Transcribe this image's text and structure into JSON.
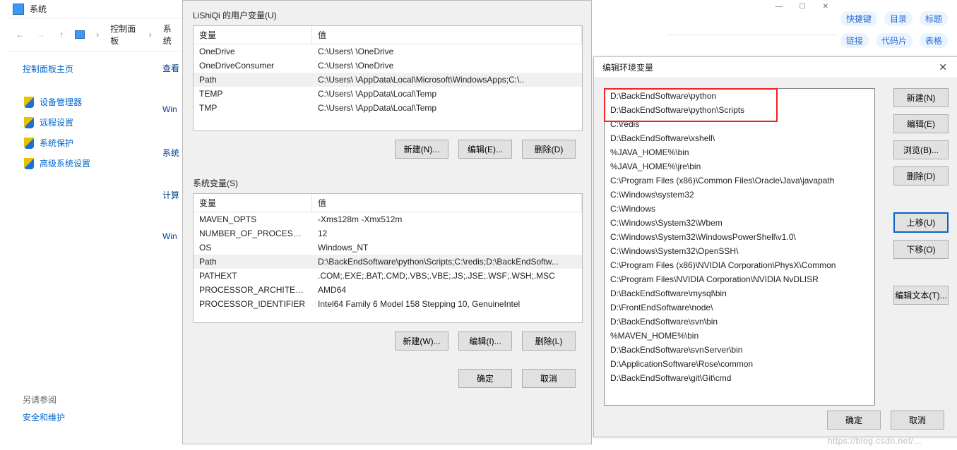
{
  "cp": {
    "title": "系统",
    "crumb1": "控制面板",
    "crumb2": "系统",
    "home": "控制面板主页",
    "items": [
      "设备管理器",
      "远程设置",
      "系统保护",
      "高级系统设置"
    ],
    "see_also": "另请参阅",
    "sec": "安全和维护"
  },
  "truncated": [
    "查看",
    "Win",
    "系统",
    "计算",
    "Win"
  ],
  "env": {
    "user_title": "LiShiQi 的用户变量(U)",
    "sys_title": "系统变量(S)",
    "col_var": "变量",
    "col_val": "值",
    "user_rows": [
      {
        "var": "OneDrive",
        "val": "C:\\Users\\        \\OneDrive"
      },
      {
        "var": "OneDriveConsumer",
        "val": "C:\\Users\\        \\OneDrive"
      },
      {
        "var": "Path",
        "val": "C:\\Users\\        \\AppData\\Local\\Microsoft\\WindowsApps;C:\\..",
        "sel": true
      },
      {
        "var": "TEMP",
        "val": "C:\\Users\\        \\AppData\\Local\\Temp"
      },
      {
        "var": "TMP",
        "val": "C:\\Users\\        \\AppData\\Local\\Temp"
      }
    ],
    "sys_rows": [
      {
        "var": "MAVEN_OPTS",
        "val": "-Xms128m -Xmx512m"
      },
      {
        "var": "NUMBER_OF_PROCESSORS",
        "val": "12"
      },
      {
        "var": "OS",
        "val": "Windows_NT"
      },
      {
        "var": "Path",
        "val": "D:\\BackEndSoftware\\python\\Scripts;C:\\redis;D:\\BackEndSoftw...",
        "sel": true
      },
      {
        "var": "PATHEXT",
        "val": ".COM;.EXE;.BAT;.CMD;.VBS;.VBE;.JS;.JSE;.WSF;.WSH;.MSC"
      },
      {
        "var": "PROCESSOR_ARCHITECT...",
        "val": "AMD64"
      },
      {
        "var": "PROCESSOR_IDENTIFIER",
        "val": "Intel64 Family 6 Model 158 Stepping 10, GenuineIntel"
      }
    ],
    "btn_new_n": "新建(N)...",
    "btn_edit_e": "编辑(E)...",
    "btn_del_d": "删除(D)",
    "btn_new_w": "新建(W)...",
    "btn_edit_i": "编辑(I)...",
    "btn_del_l": "删除(L)",
    "ok": "确定",
    "cancel": "取消"
  },
  "edit": {
    "title": "编辑环境变量",
    "items": [
      "D:\\BackEndSoftware\\python",
      "D:\\BackEndSoftware\\python\\Scripts",
      "C:\\redis",
      "D:\\BackEndSoftware\\xshell\\",
      "%JAVA_HOME%\\bin",
      "%JAVA_HOME%\\jre\\bin",
      "C:\\Program Files (x86)\\Common Files\\Oracle\\Java\\javapath",
      "C:\\Windows\\system32",
      "C:\\Windows",
      "C:\\Windows\\System32\\Wbem",
      "C:\\Windows\\System32\\WindowsPowerShell\\v1.0\\",
      "C:\\Windows\\System32\\OpenSSH\\",
      "C:\\Program Files (x86)\\NVIDIA Corporation\\PhysX\\Common",
      "C:\\Program Files\\NVIDIA Corporation\\NVIDIA NvDLISR",
      "D:\\BackEndSoftware\\mysql\\bin",
      "D:\\FrontEndSoftware\\node\\",
      "D:\\BackEndSoftware\\svn\\bin",
      "%MAVEN_HOME%\\bin",
      "D:\\BackEndSoftware\\svnServer\\bin",
      "D:\\ApplicationSoftware\\Rose\\common",
      "D:\\BackEndSoftware\\git\\Git\\cmd"
    ],
    "btns": {
      "new": "新建(N)",
      "edit": "编辑(E)",
      "browse": "浏览(B)...",
      "delete": "删除(D)",
      "up": "上移(U)",
      "down": "下移(O)",
      "text": "编辑文本(T)..."
    },
    "ok": "确定",
    "cancel": "取消"
  },
  "side": {
    "pills": [
      "快捷键",
      "目录",
      "标题",
      "链接",
      "代码片",
      "表格"
    ]
  },
  "watermark": "https://blog.csdn.net/..."
}
